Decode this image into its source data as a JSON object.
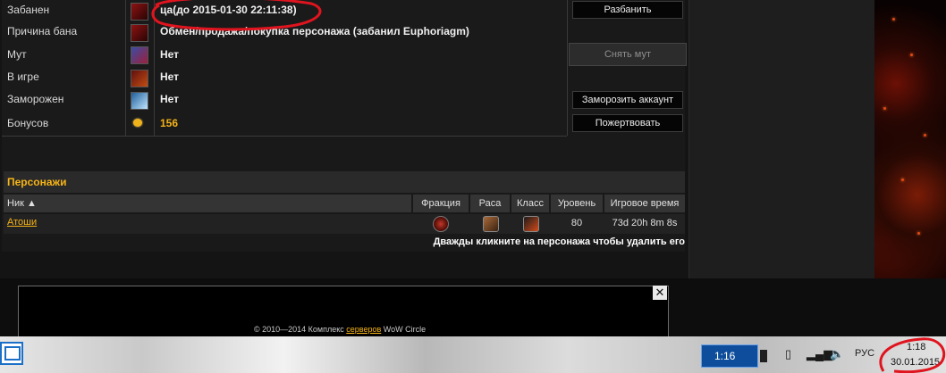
{
  "account": {
    "rows": [
      {
        "label": "Забанен",
        "value": "ца(до 2015-01-30 22:11:38)",
        "icon": "ban-hand-icon"
      },
      {
        "label": "Причина бана",
        "value": "Обмен/продажа/покупка персонажа (забанил Euphoriagm)",
        "icon": "ban-reason-icon"
      },
      {
        "label": "Мут",
        "value": "Нет",
        "icon": "mute-icon"
      },
      {
        "label": "В игре",
        "value": "Нет",
        "icon": "ingame-icon"
      },
      {
        "label": "Заморожен",
        "value": "Нет",
        "icon": "frozen-icon"
      },
      {
        "label": "Бонусов",
        "value": "156",
        "icon": "gold-coin-icon"
      }
    ],
    "buttons": {
      "unban": "Разбанить",
      "unmute": "Снять мут",
      "freeze": "Заморозить аккаунт",
      "donate": "Пожертвовать"
    }
  },
  "characters": {
    "title": "Персонажи",
    "columns": {
      "nick": "Ник ▲",
      "faction": "Фракция",
      "race": "Раса",
      "class": "Класс",
      "level": "Уровень",
      "playtime": "Игровое время"
    },
    "rows": [
      {
        "nick": "Атоши",
        "level": "80",
        "playtime": "73d 20h 8m 8s",
        "faction_icon": "horde-faction-icon",
        "race_icon": "orc-race-icon",
        "class_icon": "warrior-class-icon"
      }
    ],
    "hint": "Дважды кликните на персонажа чтобы удалить его"
  },
  "footer": {
    "copyright_prefix": "© 2010—2014 Комплекс ",
    "link": "серверов",
    "copyright_suffix": " WoW Circle",
    "close": "✕"
  },
  "taskbar": {
    "media_time": "1:16",
    "lang": "РУС",
    "clock_time": "1:18",
    "clock_date": "30.01.2015"
  },
  "colors": {
    "accent": "#f5b317",
    "annotation": "#e0141e"
  }
}
